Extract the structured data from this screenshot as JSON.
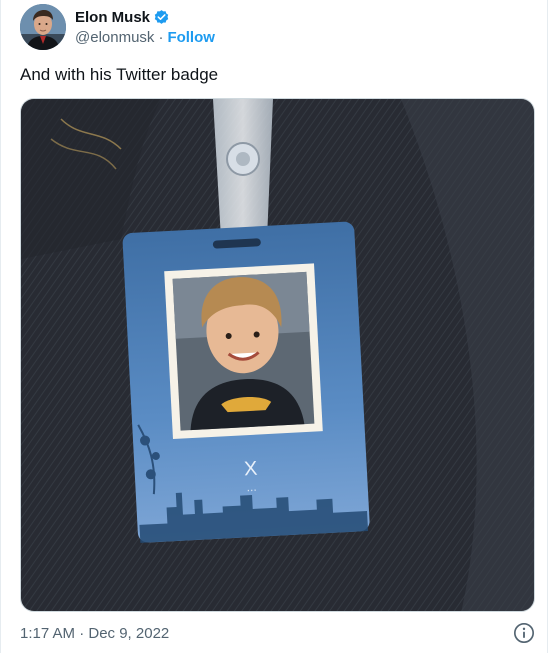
{
  "author": {
    "display_name": "Elon Musk",
    "handle": "@elonmusk",
    "separator": "·",
    "follow_label": "Follow",
    "verified": true
  },
  "tweet": {
    "text": "And with his Twitter badge",
    "timestamp": "1:17 AM · Dec 9, 2022"
  },
  "media": {
    "badge_letter": "X",
    "badge_dots": "..."
  },
  "colors": {
    "link_blue": "#1d9bf0",
    "secondary_text": "#536471",
    "badge_blue": "#4d7fb5"
  },
  "icons": [
    "verified-badge-icon",
    "info-icon"
  ]
}
